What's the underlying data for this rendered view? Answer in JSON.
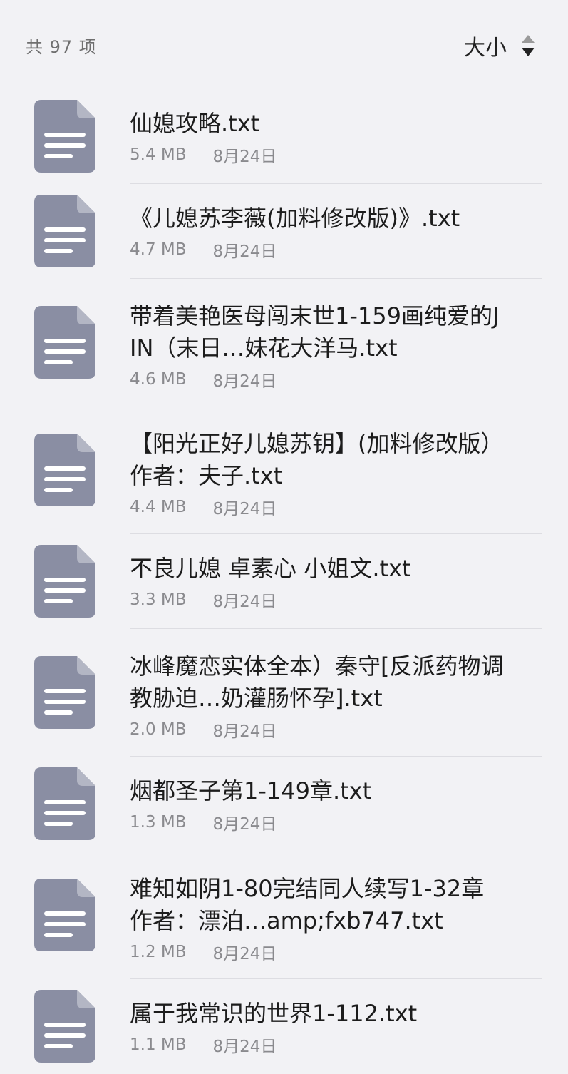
{
  "header": {
    "count_label": "共 97 项",
    "sort_label": "大小"
  },
  "colors": {
    "background": "#f2f2f5",
    "file_icon": "#8a8ea3",
    "divider": "#dddde2"
  },
  "files": [
    {
      "name": "仙媳攻略.txt",
      "size": "5.4 MB",
      "date": "8月24日",
      "icon": "text-file-icon"
    },
    {
      "name": "《儿媳苏李薇(加料修改版)》.txt",
      "size": "4.7 MB",
      "date": "8月24日",
      "icon": "text-file-icon"
    },
    {
      "name": "带着美艳医母闯末世1-159画纯爱的JIN（末日…妹花大洋马.txt",
      "size": "4.6 MB",
      "date": "8月24日",
      "icon": "text-file-icon"
    },
    {
      "name": "【阳光正好儿媳苏钥】(加料修改版）作者：夫子.txt",
      "size": "4.4 MB",
      "date": "8月24日",
      "icon": "text-file-icon"
    },
    {
      "name": "不良儿媳 卓素心 小姐文.txt",
      "size": "3.3 MB",
      "date": "8月24日",
      "icon": "text-file-icon"
    },
    {
      "name": "冰峰魔恋实体全本）秦守[反派药物调教胁迫…奶灌肠怀孕].txt",
      "size": "2.0 MB",
      "date": "8月24日",
      "icon": "text-file-icon"
    },
    {
      "name": "烟都圣子第1-149章.txt",
      "size": "1.3 MB",
      "date": "8月24日",
      "icon": "text-file-icon"
    },
    {
      "name": "难知如阴1-80完结同人续写1-32章作者：漂泊…amp;fxb747.txt",
      "size": "1.2 MB",
      "date": "8月24日",
      "icon": "text-file-icon"
    },
    {
      "name": "属于我常识的世界1-112.txt",
      "size": "1.1 MB",
      "date": "8月24日",
      "icon": "text-file-icon"
    }
  ]
}
